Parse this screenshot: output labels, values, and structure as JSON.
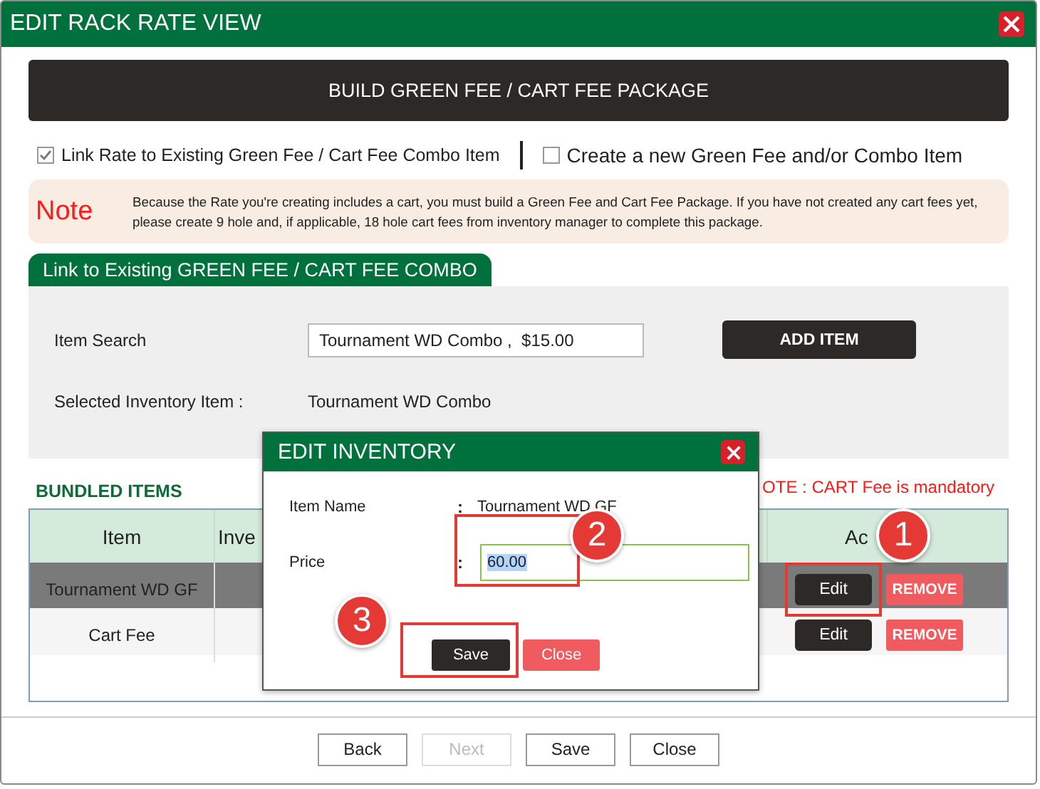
{
  "window": {
    "title": "EDIT RACK RATE VIEW"
  },
  "build_button": "BUILD GREEN FEE / CART FEE PACKAGE",
  "options": [
    {
      "label": "Link Rate to Existing Green Fee / Cart Fee Combo Item",
      "checked": true
    },
    {
      "label": "Create a new Green Fee and/or Combo Item",
      "checked": false
    }
  ],
  "note": {
    "label": "Note",
    "text": "Because the Rate you're creating includes a cart, you must build a Green Fee and Cart Fee Package. If you have not created any cart fees yet, please create 9 hole and, if applicable, 18 hole cart fees from inventory manager to complete this package."
  },
  "link_section": {
    "tab": "Link to Existing GREEN FEE / CART FEE COMBO",
    "search_label": "Item Search",
    "search_value": "Tournament WD Combo ,  $15.00",
    "add_button": "ADD ITEM",
    "selected_label": "Selected Inventory Item :",
    "selected_value": "Tournament WD Combo"
  },
  "bundled": {
    "title": "BUNDLED ITEMS",
    "notice": "OTE : CART Fee is mandatory",
    "columns": [
      "Item",
      "Inve",
      "Ac"
    ],
    "rows": [
      {
        "item": "Tournament WD GF",
        "selected": true,
        "edit": "Edit",
        "edit_highlighted": true,
        "remove": "REMOVE"
      },
      {
        "item": "Cart Fee",
        "selected": false,
        "edit": "Edit",
        "edit_highlighted": false,
        "remove": "REMOVE"
      }
    ]
  },
  "footer": [
    {
      "label": "Back",
      "disabled": false
    },
    {
      "label": "Next",
      "disabled": true
    },
    {
      "label": "Save",
      "disabled": false
    },
    {
      "label": "Close",
      "disabled": false
    }
  ],
  "dialog": {
    "title": "EDIT INVENTORY",
    "fields": [
      {
        "kind": "text",
        "label": "Item Name",
        "separator": ":",
        "value": "Tournament WD GF"
      },
      {
        "kind": "input",
        "label": "Price",
        "separator": ":",
        "value": "60.00"
      }
    ],
    "save": "Save",
    "save_highlighted": true,
    "close": "Close"
  },
  "callouts": [
    {
      "number": "1"
    },
    {
      "number": "2"
    },
    {
      "number": "3"
    }
  ]
}
